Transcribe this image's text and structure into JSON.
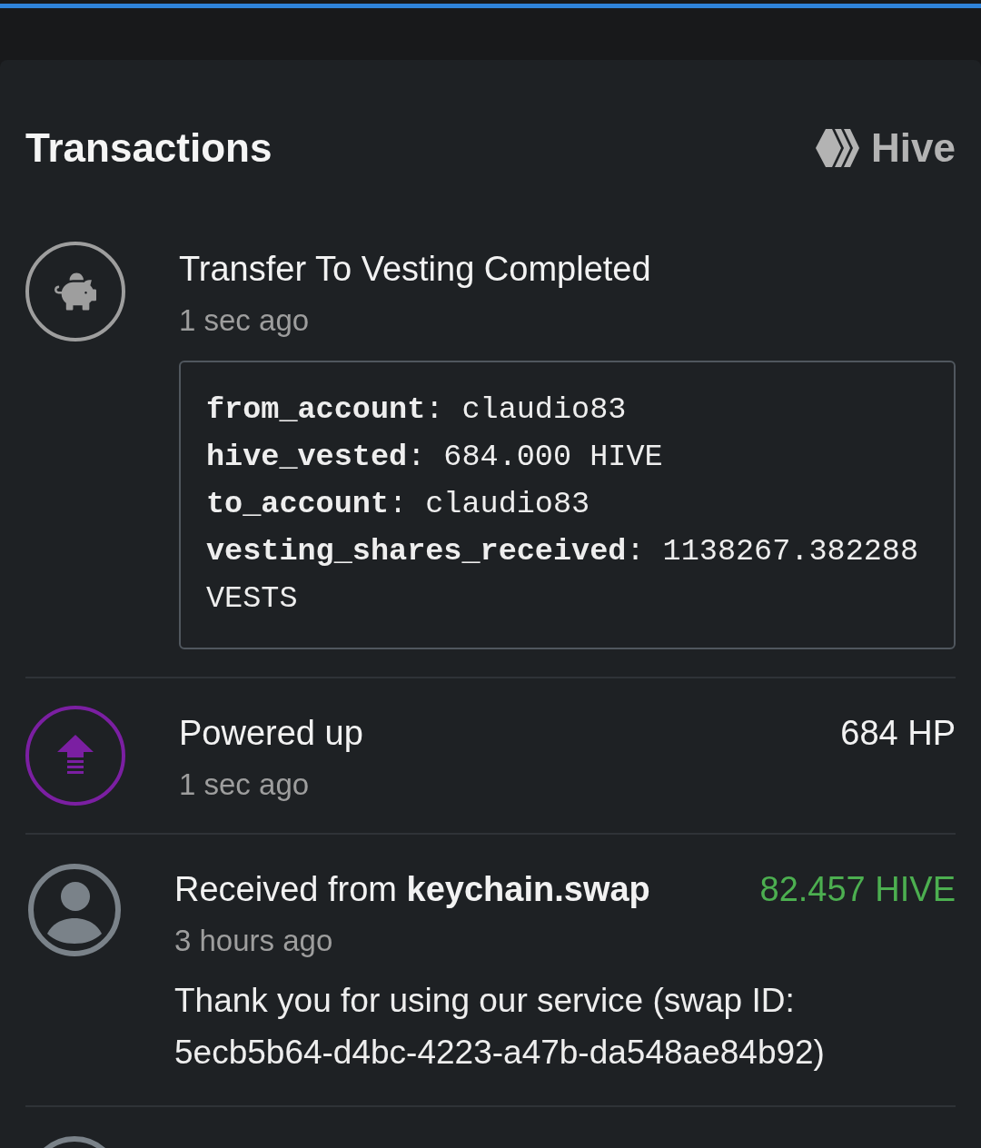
{
  "header": {
    "title": "Transactions",
    "brand": "Hive"
  },
  "transactions": [
    {
      "kind": "vesting",
      "title": "Transfer To Vesting Completed",
      "time": "1 sec ago",
      "details": [
        "**from_account**: claudio83",
        "**hive_vested**: 684.000 HIVE",
        "**to_account**: claudio83",
        "**vesting_shares_received**: 1138267.382288 VESTS"
      ]
    },
    {
      "kind": "powerup",
      "title": "Powered up",
      "time": "1 sec ago",
      "amount": {
        "text": "684 HP",
        "color": "#f2f2f2"
      }
    },
    {
      "kind": "transfer",
      "title": "Received from **keychain.swap**",
      "time": "3 hours ago",
      "amount": {
        "text": "82.457 HIVE",
        "color": "#4caf50"
      },
      "memo": "Thank you for using our service (swap ID: 5ecb5b64-d4bc-4223-a47b-da548ae84b92)"
    },
    {
      "kind": "transfer"
    }
  ]
}
